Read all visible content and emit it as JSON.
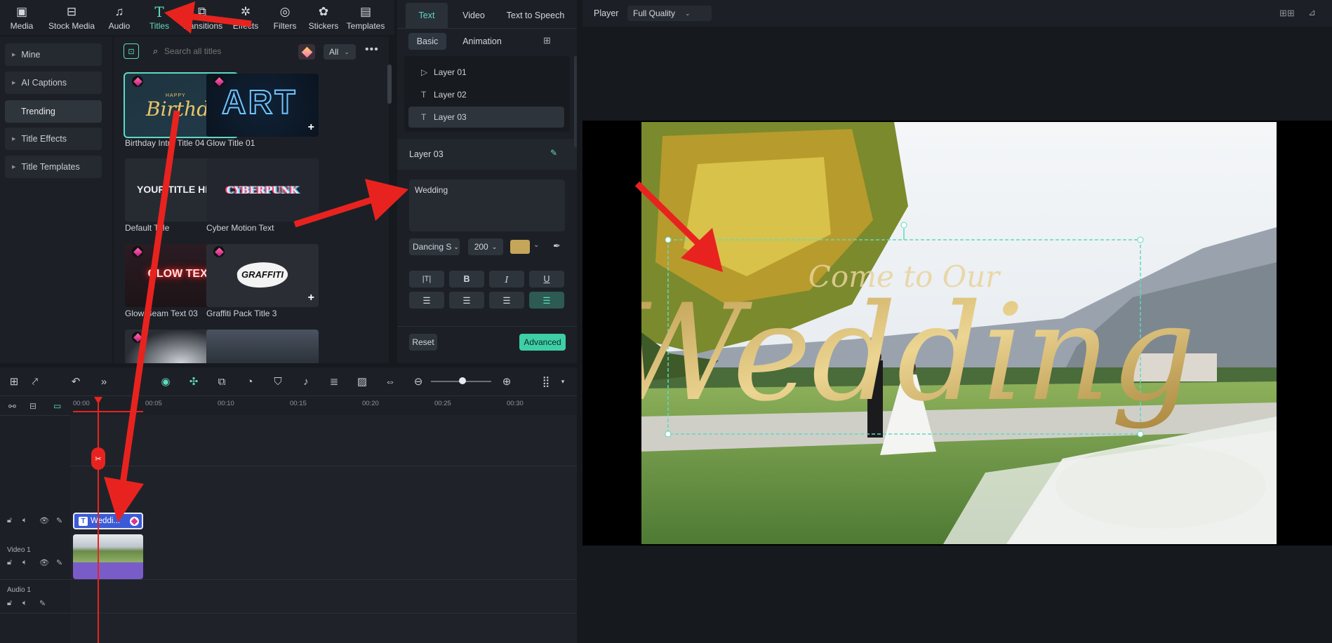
{
  "toolbar": {
    "items": [
      {
        "label": "Media",
        "icon": "media-icon"
      },
      {
        "label": "Stock Media",
        "icon": "stock-media-icon"
      },
      {
        "label": "Audio",
        "icon": "audio-icon"
      },
      {
        "label": "Titles",
        "icon": "titles-icon"
      },
      {
        "label": "Transitions",
        "icon": "transitions-icon"
      },
      {
        "label": "Effects",
        "icon": "effects-icon"
      },
      {
        "label": "Filters",
        "icon": "filters-icon"
      },
      {
        "label": "Stickers",
        "icon": "stickers-icon"
      },
      {
        "label": "Templates",
        "icon": "templates-icon"
      }
    ],
    "active": "Titles"
  },
  "sidebar": {
    "items": [
      {
        "label": "Mine"
      },
      {
        "label": "AI Captions"
      },
      {
        "label": "Trending"
      },
      {
        "label": "Title Effects"
      },
      {
        "label": "Title Templates"
      }
    ],
    "active": "Trending"
  },
  "browser": {
    "search_placeholder": "Search all titles",
    "filter_value": "All",
    "tiles": [
      {
        "label": "Birthday Intro Title 04",
        "art": "Birthday",
        "art_small": "HAPPY"
      },
      {
        "label": "Glow Title 01",
        "art": "ART"
      },
      {
        "label": "Default Title",
        "art": "YOUR TITLE HERE"
      },
      {
        "label": "Cyber Motion Text",
        "art": "CYBERPUNK"
      },
      {
        "label": "Glow Beam Text 03",
        "art": "GLOW TEXT"
      },
      {
        "label": "Graffiti Pack Title 3",
        "art": "GRAFFITI"
      }
    ]
  },
  "props": {
    "tabs": [
      "Text",
      "Video",
      "Text to Speech"
    ],
    "subtabs": [
      "Basic",
      "Animation"
    ],
    "layers": [
      "Layer 01",
      "Layer 02",
      "Layer 03"
    ],
    "section_title": "Layer 03",
    "text_value": "Wedding",
    "font": "Dancing S",
    "size": "200",
    "color": "#c4a55a",
    "style_buttons": [
      "B",
      "I",
      "U"
    ],
    "reset_label": "Reset",
    "advanced_label": "Advanced"
  },
  "player": {
    "label": "Player",
    "quality": "Full Quality",
    "overlay_line1": "Come to Our",
    "overlay_line2": "Wedding"
  },
  "timeline": {
    "ruler": [
      "00:00",
      "00:05",
      "00:10",
      "00:15",
      "00:20",
      "00:25",
      "00:30"
    ],
    "title_clip": "Weddi...",
    "tracks": [
      "Video 1",
      "Audio 1"
    ]
  },
  "colors": {
    "accent": "#5fd9c1",
    "arrow": "#e8231f",
    "clip_title": "#3b5bd6",
    "clip_video": "#7a5cc9"
  }
}
